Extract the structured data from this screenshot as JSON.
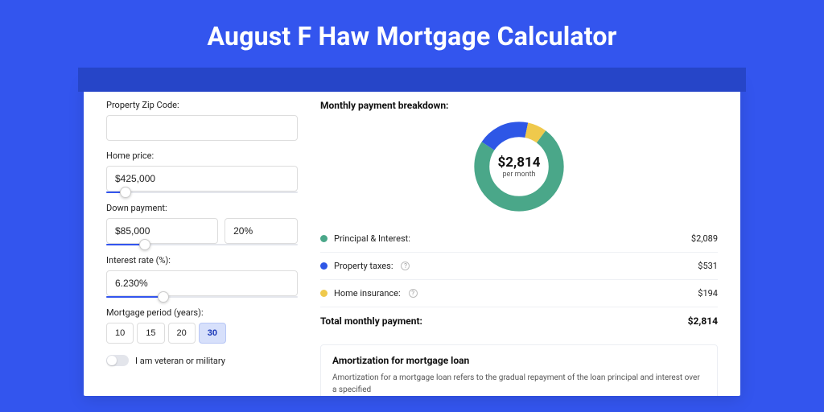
{
  "title": "August F Haw Mortgage Calculator",
  "form": {
    "zip": {
      "label": "Property Zip Code:",
      "value": ""
    },
    "home_price": {
      "label": "Home price:",
      "value": "$425,000",
      "slider_pct": 10
    },
    "down_payment": {
      "label": "Down payment:",
      "value": "$85,000",
      "pct": "20%",
      "slider_pct": 20
    },
    "interest": {
      "label": "Interest rate (%):",
      "value": "6.230%",
      "slider_pct": 30
    },
    "period": {
      "label": "Mortgage period (years):",
      "options": [
        "10",
        "15",
        "20",
        "30"
      ],
      "active": "30"
    },
    "veteran": {
      "label": "I am veteran or military",
      "on": false
    }
  },
  "breakdown": {
    "title": "Monthly payment breakdown:",
    "center_amount": "$2,814",
    "center_sub": "per month",
    "items": [
      {
        "label": "Principal & Interest:",
        "value": "$2,089",
        "color": "#4aa789",
        "info": false
      },
      {
        "label": "Property taxes:",
        "value": "$531",
        "color": "#2e57e6",
        "info": true
      },
      {
        "label": "Home insurance:",
        "value": "$194",
        "color": "#efc94c",
        "info": true
      }
    ],
    "total_label": "Total monthly payment:",
    "total_value": "$2,814"
  },
  "amort": {
    "title": "Amortization for mortgage loan",
    "text": "Amortization for a mortgage loan refers to the gradual repayment of the loan principal and interest over a specified"
  },
  "chart_data": {
    "type": "pie",
    "title": "Monthly payment breakdown",
    "series": [
      {
        "name": "Principal & Interest",
        "value": 2089,
        "color": "#4aa789"
      },
      {
        "name": "Property taxes",
        "value": 531,
        "color": "#2e57e6"
      },
      {
        "name": "Home insurance",
        "value": 194,
        "color": "#efc94c"
      }
    ],
    "total": 2814,
    "center_label": "$2,814 per month"
  }
}
